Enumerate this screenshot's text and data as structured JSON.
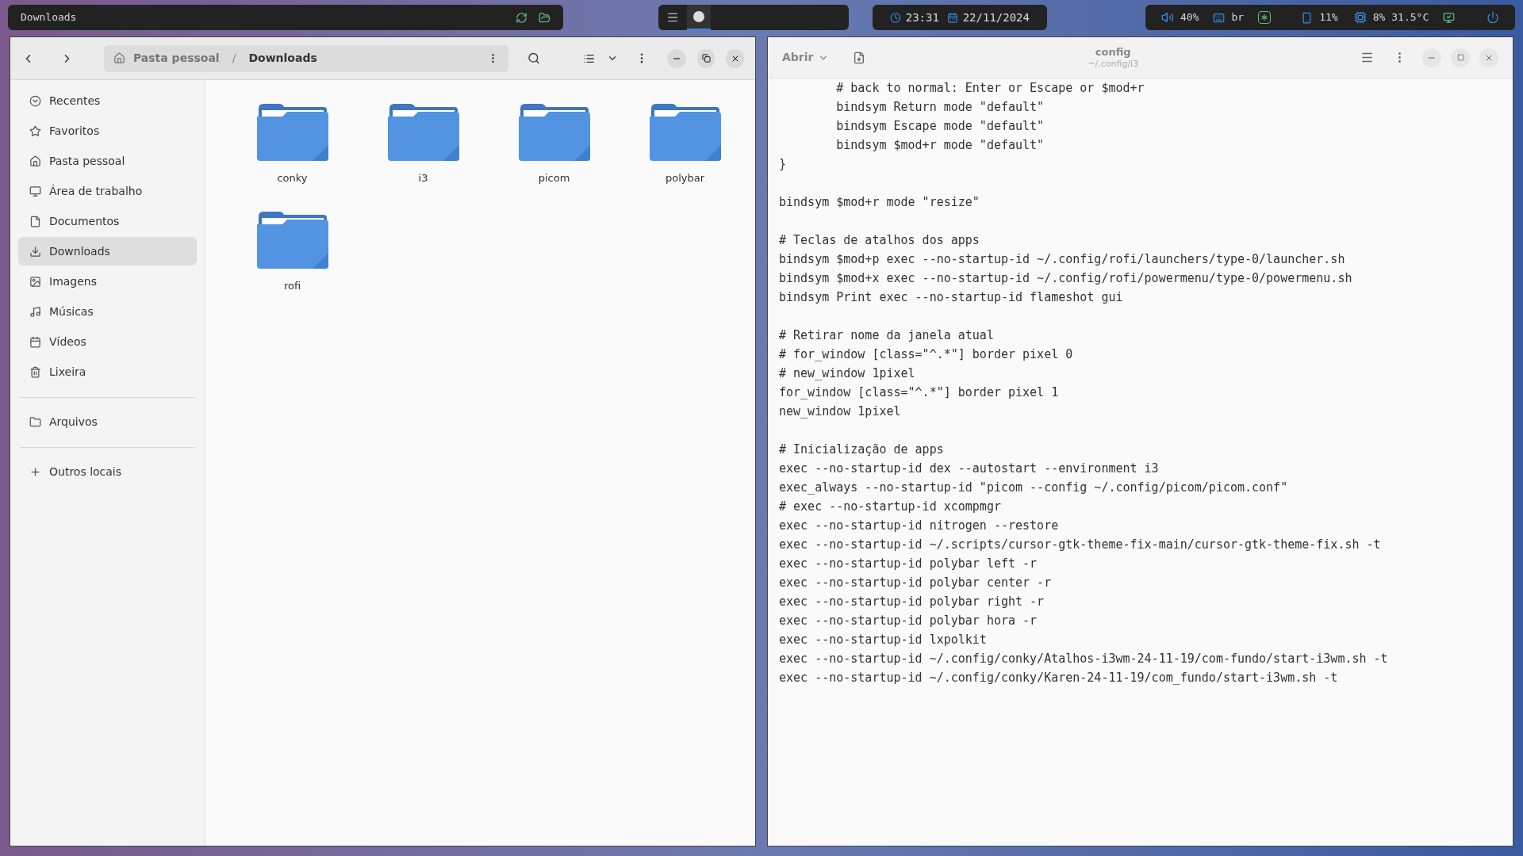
{
  "top_bar": {
    "window_title": "Downloads",
    "time": "23:31",
    "date": "22/11/2024",
    "volume": "40%",
    "keyboard": "br",
    "battery": "11%",
    "cpu": "8%",
    "temperature": "31.5°C"
  },
  "file_manager": {
    "path": [
      "Pasta pessoal",
      "/",
      "Downloads"
    ],
    "sidebar": [
      {
        "label": "Recentes",
        "selected": false
      },
      {
        "label": "Favoritos",
        "selected": false
      },
      {
        "label": "Pasta pessoal",
        "selected": false
      },
      {
        "label": "Área de trabalho",
        "selected": false
      },
      {
        "label": "Documentos",
        "selected": false
      },
      {
        "label": "Downloads",
        "selected": true
      },
      {
        "label": "Imagens",
        "selected": false
      },
      {
        "label": "Músicas",
        "selected": false
      },
      {
        "label": "Vídeos",
        "selected": false
      },
      {
        "label": "Lixeira",
        "selected": false
      },
      {
        "label": "Arquivos",
        "selected": false
      },
      {
        "label": "Outros locais",
        "selected": false
      }
    ],
    "folders": [
      "conky",
      "i3",
      "picom",
      "polybar",
      "rofi"
    ]
  },
  "editor": {
    "open_button": "Abrir",
    "title": "config",
    "subtitle": "~/.config/i3",
    "blocks": [
      [
        "        # back to normal: Enter or Escape or $mod+r",
        "        bindsym Return mode \"default\"",
        "        bindsym Escape mode \"default\"",
        "        bindsym $mod+r mode \"default\"",
        "}"
      ],
      [
        "bindsym $mod+r mode \"resize\""
      ],
      [
        "# Teclas de atalhos dos apps",
        "bindsym $mod+p exec --no-startup-id ~/.config/rofi/launchers/type-0/launcher.sh",
        "bindsym $mod+x exec --no-startup-id ~/.config/rofi/powermenu/type-0/powermenu.sh",
        "bindsym Print exec --no-startup-id flameshot gui"
      ],
      [
        "# Retirar nome da janela atual",
        "# for_window [class=\"^.*\"] border pixel 0",
        "# new_window 1pixel",
        "for_window [class=\"^.*\"] border pixel 1",
        "new_window 1pixel"
      ],
      [
        "# Inicialização de apps",
        "exec --no-startup-id dex --autostart --environment i3",
        "exec_always --no-startup-id \"picom --config ~/.config/picom/picom.conf\"",
        "# exec --no-startup-id xcompmgr",
        "exec --no-startup-id nitrogen --restore",
        "exec --no-startup-id ~/.scripts/cursor-gtk-theme-fix-main/cursor-gtk-theme-fix.sh -t",
        "exec --no-startup-id polybar left -r",
        "exec --no-startup-id polybar center -r",
        "exec --no-startup-id polybar right -r",
        "exec --no-startup-id polybar hora -r",
        "exec --no-startup-id lxpolkit",
        "exec --no-startup-id ~/.config/conky/Atalhos-i3wm-24-11-19/com-fundo/start-i3wm.sh -t",
        "exec --no-startup-id ~/.config/conky/Karen-24-11-19/com_fundo/start-i3wm.sh -t"
      ]
    ]
  }
}
